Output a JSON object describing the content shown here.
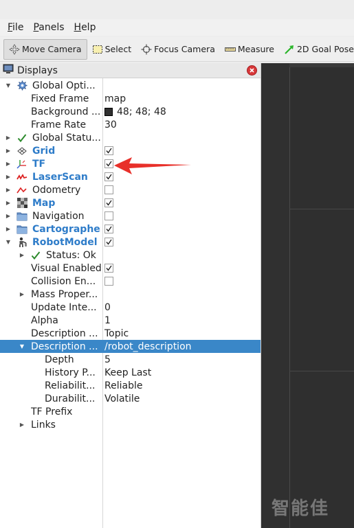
{
  "menu": [
    {
      "mnemonic": "F",
      "rest": "ile"
    },
    {
      "mnemonic": "P",
      "rest": "anels"
    },
    {
      "mnemonic": "H",
      "rest": "elp"
    }
  ],
  "toolbar": {
    "move_camera": "Move Camera",
    "select": "Select",
    "focus_camera": "Focus Camera",
    "measure": "Measure",
    "goal_pose": "2D Goal Pose"
  },
  "panel": {
    "title": "Displays"
  },
  "tree": {
    "global_options": "Global Opti...",
    "fixed_frame": {
      "label": "Fixed Frame",
      "value": "map"
    },
    "background": {
      "label": "Background ...",
      "value": "48; 48; 48"
    },
    "frame_rate": {
      "label": "Frame Rate",
      "value": "30"
    },
    "global_status": "Global Statu...",
    "grid": "Grid",
    "tf": "TF",
    "laserscan": "LaserScan",
    "odometry": "Odometry",
    "map": "Map",
    "navigation": "Navigation",
    "cartographer": "Cartographer",
    "robotmodel": "RobotModel",
    "status_ok": "Status: Ok",
    "visual_enabled": "Visual Enabled",
    "collision_enabled": "Collision En...",
    "mass_properties": "Mass Proper...",
    "update_interval": {
      "label": "Update Inte...",
      "value": "0"
    },
    "alpha": {
      "label": "Alpha",
      "value": "1"
    },
    "description_source": {
      "label": "Description ...",
      "value": "Topic"
    },
    "description_topic": {
      "label": "Description ...",
      "value": "/robot_description"
    },
    "depth": {
      "label": "Depth",
      "value": "5"
    },
    "history_policy": {
      "label": "History P...",
      "value": "Keep Last"
    },
    "reliability": {
      "label": "Reliabilit...",
      "value": "Reliable"
    },
    "durability": {
      "label": "Durabilit...",
      "value": "Volatile"
    },
    "tf_prefix": "TF Prefix",
    "links": "Links"
  },
  "checkboxes": {
    "grid": true,
    "tf": true,
    "laserscan": true,
    "odometry": false,
    "map": true,
    "navigation": false,
    "cartographer": true,
    "robotmodel": true,
    "visual_enabled": true,
    "collision_enabled": false
  },
  "colors": {
    "selection": "#3a87c8",
    "display_name_blue": "#2e7cc9",
    "viewport_bg": "#303030",
    "annotation_arrow": "#e8302a"
  },
  "watermark": "智能佳"
}
